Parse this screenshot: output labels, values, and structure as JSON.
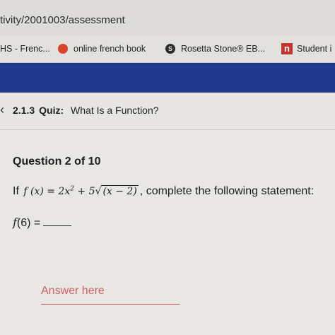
{
  "browser": {
    "url": "tivity/2001003/assessment",
    "bookmarks": [
      {
        "label": "HS - Frenc...",
        "icon": "bookmark-icon"
      },
      {
        "label": "online french book",
        "icon": "red-circle-icon",
        "color": "#d9442a"
      },
      {
        "label": "Rosetta Stone® EB...",
        "icon": "rosetta-stone-icon"
      },
      {
        "label": "Student i",
        "icon": "n-logo-icon",
        "color": "#c8352f"
      }
    ]
  },
  "nav": {
    "color": "#1f3a8c"
  },
  "quiz": {
    "number": "2.1.3",
    "type": "Quiz:",
    "title": "What Is a Function?"
  },
  "question": {
    "label": "Question 2 of 10",
    "intro": "If",
    "formula_lhs": "f (x) = 2x",
    "formula_exp": "2",
    "formula_mid": " + 5",
    "formula_sqrt": "(x − 2)",
    "statement": ", complete the following statement:",
    "prompt_fn": "f",
    "prompt_rest": "(6) ="
  },
  "answer": {
    "placeholder": "Answer here",
    "color": "#d35a5a"
  }
}
